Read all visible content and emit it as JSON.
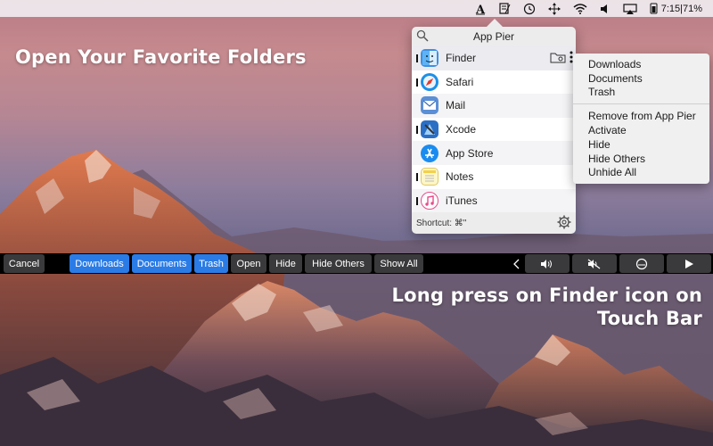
{
  "menubar": {
    "icons": [
      "text-input-icon",
      "notes-icon",
      "time-machine-icon",
      "move-icon",
      "wifi-icon",
      "volume-icon",
      "airplay-icon",
      "battery-icon"
    ],
    "clock_battery": "7:15|71%"
  },
  "headlines": {
    "top": "Open Your Favorite Folders",
    "bottom_line1": "Long press on Finder icon on",
    "bottom_line2": "Touch Bar"
  },
  "pier": {
    "title": "App Pier",
    "apps": [
      {
        "name": "Finder",
        "running": true,
        "icon": "finder-icon",
        "color": "#3d8fe4"
      },
      {
        "name": "Safari",
        "running": true,
        "icon": "safari-icon",
        "color": "#1c8fe8"
      },
      {
        "name": "Mail",
        "running": false,
        "icon": "mail-icon",
        "color": "#5b8fd6"
      },
      {
        "name": "Xcode",
        "running": true,
        "icon": "xcode-icon",
        "color": "#2b6fc4"
      },
      {
        "name": "App Store",
        "running": false,
        "icon": "app-store-icon",
        "color": "#1a8cf0"
      },
      {
        "name": "Notes",
        "running": true,
        "icon": "notes-app-icon",
        "color": "#f4d04a"
      },
      {
        "name": "iTunes",
        "running": true,
        "icon": "itunes-icon",
        "color": "#e84d8a"
      }
    ],
    "shortcut": "Shortcut: ⌘\""
  },
  "context_menu": {
    "folders": [
      "Downloads",
      "Documents",
      "Trash"
    ],
    "actions": [
      "Remove from App Pier",
      "Activate",
      "Hide",
      "Hide Others",
      "Unhide All"
    ]
  },
  "touchbar": {
    "cancel": "Cancel",
    "folders": [
      "Downloads",
      "Documents",
      "Trash"
    ],
    "actions": [
      "Open",
      "Hide",
      "Hide Others",
      "Show All"
    ],
    "accent": "#2a7be6"
  }
}
